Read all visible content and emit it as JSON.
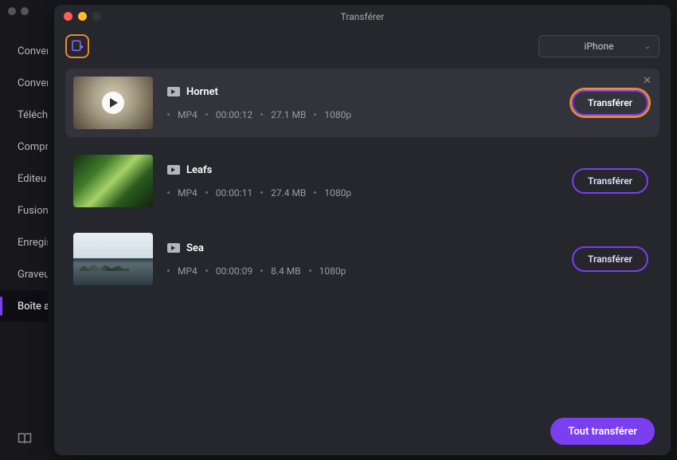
{
  "window_title": "Transférer",
  "sidebar": {
    "items": [
      {
        "label": "Conver"
      },
      {
        "label": "Conver"
      },
      {
        "label": "Téléch"
      },
      {
        "label": "Compr"
      },
      {
        "label": "Editeu"
      },
      {
        "label": "Fusion"
      },
      {
        "label": "Enregis"
      },
      {
        "label": "Graveu"
      },
      {
        "label": "Boîte a"
      }
    ]
  },
  "toolbar": {
    "device": "iPhone"
  },
  "items": [
    {
      "title": "Hornet",
      "format": "MP4",
      "duration": "00:00:12",
      "size": "27.1 MB",
      "res": "1080p",
      "button": "Transférer"
    },
    {
      "title": "Leafs",
      "format": "MP4",
      "duration": "00:00:11",
      "size": "27.4 MB",
      "res": "1080p",
      "button": "Transférer"
    },
    {
      "title": "Sea",
      "format": "MP4",
      "duration": "00:00:09",
      "size": "8.4 MB",
      "res": "1080p",
      "button": "Transférer"
    }
  ],
  "footer": {
    "transfer_all": "Tout transférer"
  }
}
